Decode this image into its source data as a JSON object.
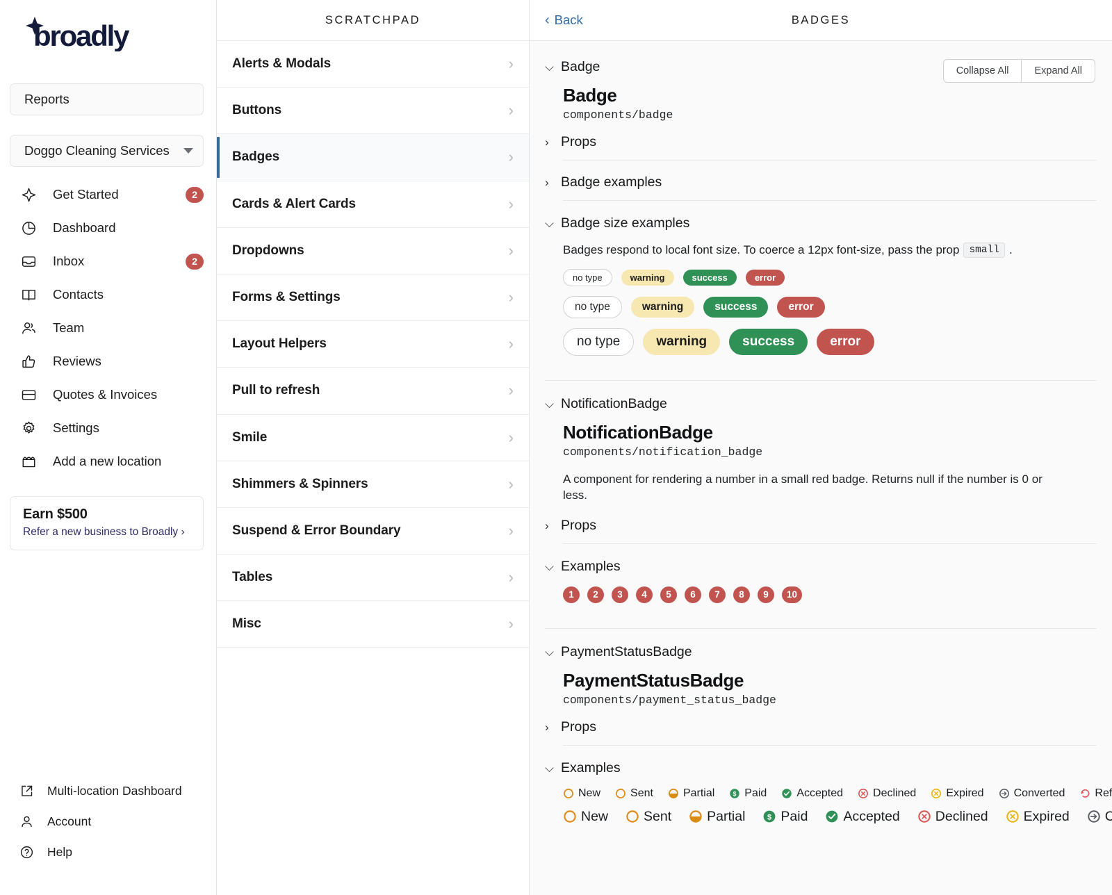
{
  "sidebar": {
    "brand": "broadly",
    "reports_label": "Reports",
    "location": "Doggo Cleaning Services",
    "nav": [
      {
        "label": "Get Started",
        "icon": "sparkle-icon",
        "badge": "2"
      },
      {
        "label": "Dashboard",
        "icon": "pie-chart-icon",
        "badge": ""
      },
      {
        "label": "Inbox",
        "icon": "inbox-icon",
        "badge": "2"
      },
      {
        "label": "Contacts",
        "icon": "book-icon",
        "badge": ""
      },
      {
        "label": "Team",
        "icon": "people-icon",
        "badge": ""
      },
      {
        "label": "Reviews",
        "icon": "thumbs-up-icon",
        "badge": ""
      },
      {
        "label": "Quotes & Invoices",
        "icon": "credit-card-icon",
        "badge": ""
      },
      {
        "label": "Settings",
        "icon": "gear-icon",
        "badge": ""
      },
      {
        "label": "Add a new location",
        "icon": "storefront-icon",
        "badge": ""
      }
    ],
    "promo": {
      "title": "Earn $500",
      "subtitle": "Refer a new business to Broadly ›"
    },
    "footer": [
      {
        "label": "Multi-location Dashboard",
        "icon": "external-link-icon"
      },
      {
        "label": "Account",
        "icon": "user-icon"
      },
      {
        "label": "Help",
        "icon": "question-circle-icon"
      }
    ]
  },
  "scratchpad": {
    "title": "SCRATCHPAD",
    "items": [
      {
        "label": "Alerts & Modals",
        "active": false
      },
      {
        "label": "Buttons",
        "active": false
      },
      {
        "label": "Badges",
        "active": true
      },
      {
        "label": "Cards & Alert Cards",
        "active": false
      },
      {
        "label": "Dropdowns",
        "active": false
      },
      {
        "label": "Forms & Settings",
        "active": false
      },
      {
        "label": "Layout Helpers",
        "active": false
      },
      {
        "label": "Pull to refresh",
        "active": false
      },
      {
        "label": "Smile",
        "active": false
      },
      {
        "label": "Shimmers & Spinners",
        "active": false
      },
      {
        "label": "Suspend & Error Boundary",
        "active": false
      },
      {
        "label": "Tables",
        "active": false
      },
      {
        "label": "Misc",
        "active": false
      }
    ]
  },
  "detail": {
    "back_label": "Back",
    "title": "BADGES",
    "collapse_all": "Collapse All",
    "expand_all": "Expand All",
    "badge_section": {
      "header": "Badge",
      "name": "Badge",
      "path": "components/badge",
      "props_label": "Props",
      "examples_label": "Badge examples",
      "size_examples_label": "Badge size examples",
      "size_note_pre": "Badges respond to local font size. To coerce a 12px font-size, pass the prop",
      "size_note_code": "small",
      "size_note_post": ".",
      "badge_labels": [
        "no type",
        "warning",
        "success",
        "error"
      ]
    },
    "notification_section": {
      "header": "NotificationBadge",
      "name": "NotificationBadge",
      "path": "components/notification_badge",
      "description": "A component for rendering a number in a small red badge. Returns null if the number is 0 or less.",
      "props_label": "Props",
      "examples_label": "Examples",
      "numbers": [
        "1",
        "2",
        "3",
        "4",
        "5",
        "6",
        "7",
        "8",
        "9",
        "10"
      ]
    },
    "payment_section": {
      "header": "PaymentStatusBadge",
      "name": "PaymentStatusBadge",
      "path": "components/payment_status_badge",
      "props_label": "Props",
      "examples_label": "Examples",
      "statuses_small": [
        {
          "label": "New",
          "icon": "circle-outline-icon",
          "color": "#e08c1a"
        },
        {
          "label": "Sent",
          "icon": "circle-outline-icon",
          "color": "#e08c1a"
        },
        {
          "label": "Partial",
          "icon": "half-filled-circle-icon",
          "color": "#d98b12"
        },
        {
          "label": "Paid",
          "icon": "dollar-circle-icon",
          "color": "#2f9155"
        },
        {
          "label": "Accepted",
          "icon": "check-circle-icon",
          "color": "#2f9155"
        },
        {
          "label": "Declined",
          "icon": "x-circle-icon",
          "color": "#d9534f"
        },
        {
          "label": "Expired",
          "icon": "x-circle-icon",
          "color": "#eab308"
        },
        {
          "label": "Converted",
          "icon": "arrow-circle-icon",
          "color": "#5a5f66"
        },
        {
          "label": "Refunded",
          "icon": "undo-arrow-icon",
          "color": "#e0525c"
        }
      ],
      "statuses_large": [
        {
          "label": "New",
          "icon": "circle-outline-icon",
          "color": "#e08c1a"
        },
        {
          "label": "Sent",
          "icon": "circle-outline-icon",
          "color": "#e08c1a"
        },
        {
          "label": "Partial",
          "icon": "half-filled-circle-icon",
          "color": "#d98b12"
        },
        {
          "label": "Paid",
          "icon": "dollar-circle-icon",
          "color": "#2f9155"
        },
        {
          "label": "Accepted",
          "icon": "check-circle-icon",
          "color": "#2f9155"
        },
        {
          "label": "Declined",
          "icon": "x-circle-icon",
          "color": "#d9534f"
        },
        {
          "label": "Expired",
          "icon": "x-circle-icon",
          "color": "#eab308"
        },
        {
          "label": "Converted",
          "icon": "arrow-circle-icon",
          "color": "#5a5f66"
        }
      ]
    }
  },
  "colors": {
    "accent_blue": "#2f6ca8",
    "brand_navy": "#131a3a",
    "badge_red": "#c25450",
    "badge_green": "#2f9155",
    "badge_yellow": "#f6e8b0",
    "active_bar": "#3a6b96"
  }
}
